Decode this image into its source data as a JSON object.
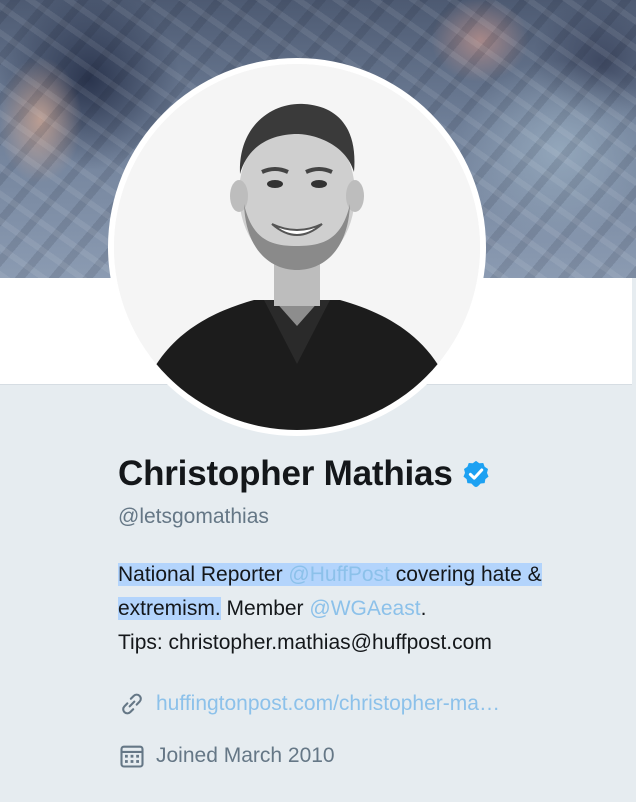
{
  "header": {
    "photo_alt": "header photo"
  },
  "profile": {
    "name": "Christopher Mathias",
    "handle": "@letsgomathias",
    "verified": true,
    "bio": {
      "part1": "National Reporter ",
      "mention1": "@HuffPost",
      "part2": " covering hate & extremism.",
      "part3": " Member ",
      "mention2": "@WGAeast",
      "part4": ".",
      "line3": "Tips: christopher.mathias@huffpost.com"
    },
    "website": "huffingtonpost.com/christopher-ma…",
    "joined": "Joined March 2010"
  },
  "colors": {
    "link": "#8cc1ea",
    "verified": "#1da1f2",
    "selection": "#b3d4fc",
    "muted": "#657786",
    "text": "#14171a"
  },
  "icons": {
    "verified": "verified-badge-icon",
    "link": "link-icon",
    "calendar": "calendar-icon"
  }
}
